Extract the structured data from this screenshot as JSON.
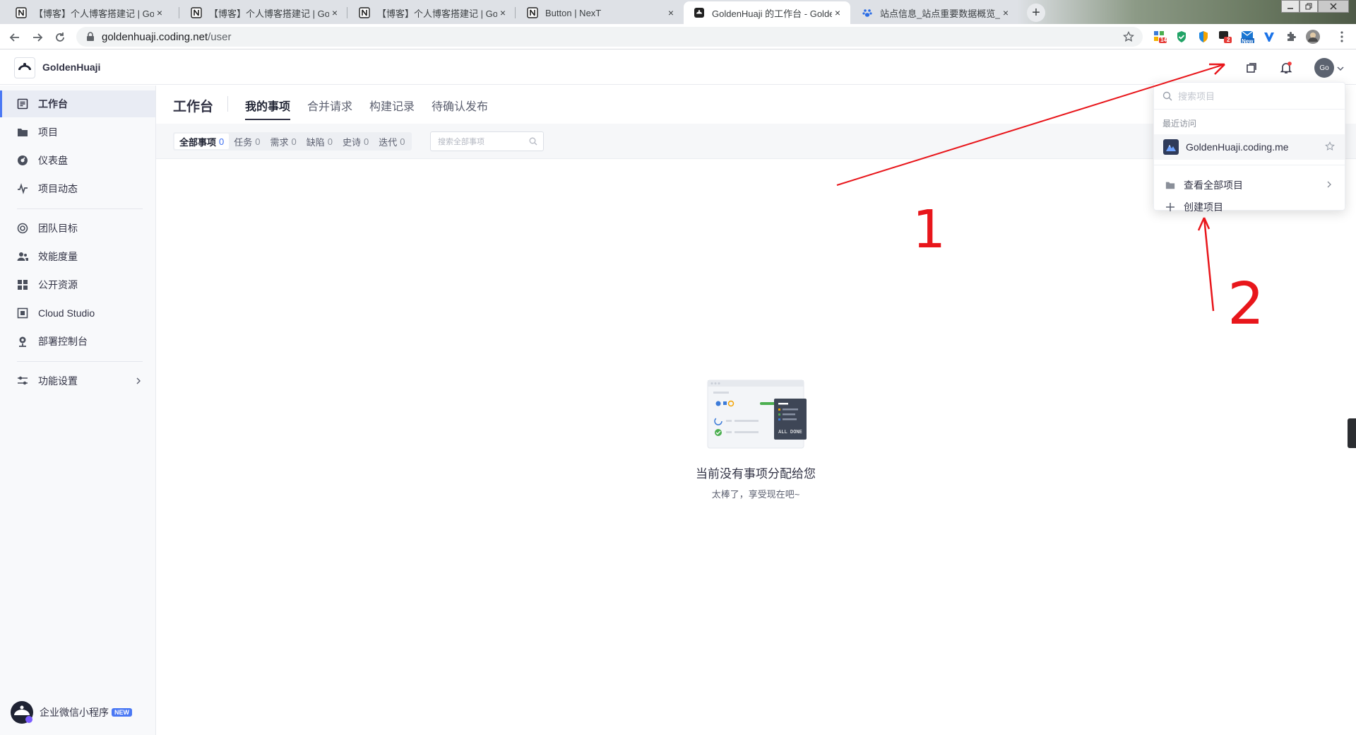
{
  "browser": {
    "tabs": [
      {
        "title": "【博客】个人博客搭建记 | Golde",
        "favicon": "notion-icon",
        "active": false
      },
      {
        "title": "【博客】个人博客搭建记 | Golde",
        "favicon": "notion-icon",
        "active": false
      },
      {
        "title": "【博客】个人博客搭建记 | Golde",
        "favicon": "notion-icon",
        "active": false
      },
      {
        "title": "Button | NexT",
        "favicon": "notion-icon",
        "active": false
      },
      {
        "title": "GoldenHuaji 的工作台 - Golden",
        "favicon": "coding-icon",
        "active": true
      },
      {
        "title": "站点信息_站点重要数据概览_站",
        "favicon": "baidu-paw-icon",
        "active": false
      }
    ],
    "tab_close": "×",
    "new_tab": "+",
    "url_domain": "goldenhuaji.coding.net",
    "url_path": "/user",
    "ext_badges": {
      "first": "14",
      "second": "2",
      "third": "New"
    }
  },
  "header": {
    "team_name": "GoldenHuaji",
    "avatar_text": "Go"
  },
  "sidebar": {
    "items": [
      {
        "label": "工作台",
        "icon": "workbench-icon",
        "active": true
      },
      {
        "label": "项目",
        "icon": "folder-icon"
      },
      {
        "label": "仪表盘",
        "icon": "dashboard-icon"
      },
      {
        "label": "项目动态",
        "icon": "activity-icon"
      },
      {
        "label": "团队目标",
        "icon": "target-icon"
      },
      {
        "label": "效能度量",
        "icon": "users-metric-icon"
      },
      {
        "label": "公开资源",
        "icon": "grid-icon"
      },
      {
        "label": "Cloud Studio",
        "icon": "cloud-studio-icon"
      },
      {
        "label": "部署控制台",
        "icon": "deploy-icon"
      },
      {
        "label": "功能设置",
        "icon": "settings-sliders-icon"
      }
    ],
    "mini_program": "企业微信小程序",
    "mini_badge": "NEW"
  },
  "main": {
    "title": "工作台",
    "tabs": [
      {
        "label": "我的事项",
        "active": true
      },
      {
        "label": "合并请求"
      },
      {
        "label": "构建记录"
      },
      {
        "label": "待确认发布"
      }
    ],
    "filters": [
      {
        "label": "全部事项",
        "count": "0",
        "active": true
      },
      {
        "label": "任务",
        "count": "0"
      },
      {
        "label": "需求",
        "count": "0"
      },
      {
        "label": "缺陷",
        "count": "0"
      },
      {
        "label": "史诗",
        "count": "0"
      },
      {
        "label": "迭代",
        "count": "0"
      }
    ],
    "search_placeholder": "搜索全部事项",
    "empty_title": "当前没有事项分配给您",
    "empty_subtitle": "太棒了，享受现在吧~",
    "illustration_text": "ALL DONE"
  },
  "dropdown": {
    "search_placeholder": "搜索项目",
    "recent_label": "最近访问",
    "recent_project": "GoldenHuaji.coding.me",
    "view_all": "查看全部项目",
    "create": "创建项目"
  },
  "annotations": {
    "label_1": "1",
    "label_2": "2",
    "color": "#e8161b"
  },
  "colors": {
    "accent": "#4a78f4",
    "sidebar_bg": "#f8f9fb",
    "text": "#323345"
  }
}
